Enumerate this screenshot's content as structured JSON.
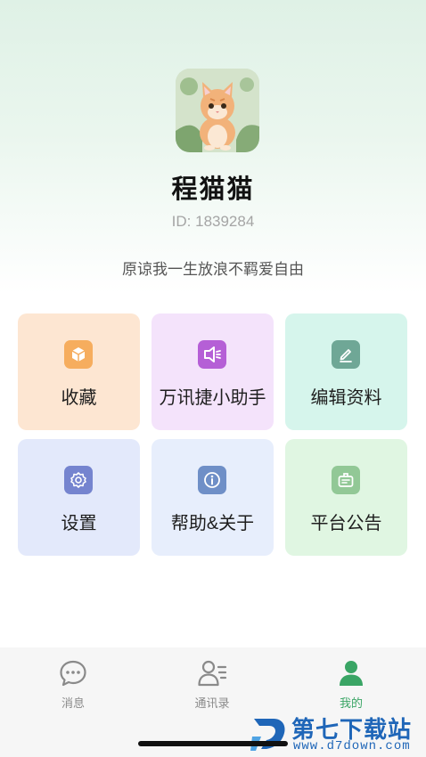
{
  "profile": {
    "name": "程猫猫",
    "id_text": "ID: 1839284",
    "signature": "原谅我一生放浪不羁爱自由"
  },
  "menu": [
    {
      "label": "收藏",
      "icon": "box-icon",
      "bg": "#fde6d2",
      "icon_bg": "#f6ad5e"
    },
    {
      "label": "万讯捷小助手",
      "icon": "speaker-icon",
      "bg": "#f4e3fb",
      "icon_bg": "#b55fd6"
    },
    {
      "label": "编辑资料",
      "icon": "edit-icon",
      "bg": "#d6f5ec",
      "icon_bg": "#6fa796"
    },
    {
      "label": "设置",
      "icon": "gear-icon",
      "bg": "#e3e9fb",
      "icon_bg": "#7584cf"
    },
    {
      "label": "帮助&关于",
      "icon": "info-icon",
      "bg": "#e7eefc",
      "icon_bg": "#6f8fc7"
    },
    {
      "label": "平台公告",
      "icon": "announcement-icon",
      "bg": "#e0f6e2",
      "icon_bg": "#92c896"
    }
  ],
  "tabs": [
    {
      "label": "消息",
      "icon": "chat-icon",
      "active": false
    },
    {
      "label": "通讯录",
      "icon": "contacts-icon",
      "active": false
    },
    {
      "label": "我的",
      "icon": "profile-icon",
      "active": true
    }
  ],
  "colors": {
    "accent": "#3aa565",
    "inactive": "#8a8a8a"
  },
  "watermark": {
    "title": "第七下载站",
    "url": "www.d7down.com"
  }
}
